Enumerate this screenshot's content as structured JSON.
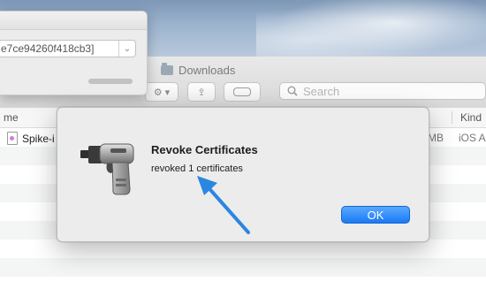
{
  "background_window": {
    "selected_value": "e7ce94260f418cb3]"
  },
  "finder": {
    "title": "Downloads",
    "search": {
      "placeholder": "Search"
    },
    "columns": {
      "name": "me",
      "kind": "Kind"
    },
    "rows": [
      {
        "name": "Spike-i",
        "size": "MB",
        "kind": "iOS A"
      }
    ]
  },
  "dialog": {
    "title": "Revoke Certificates",
    "message": "revoked 1 certificates",
    "ok_label": "OK"
  },
  "colors": {
    "accent": "#1a7af4",
    "annotation_arrow": "#2b86e0"
  }
}
